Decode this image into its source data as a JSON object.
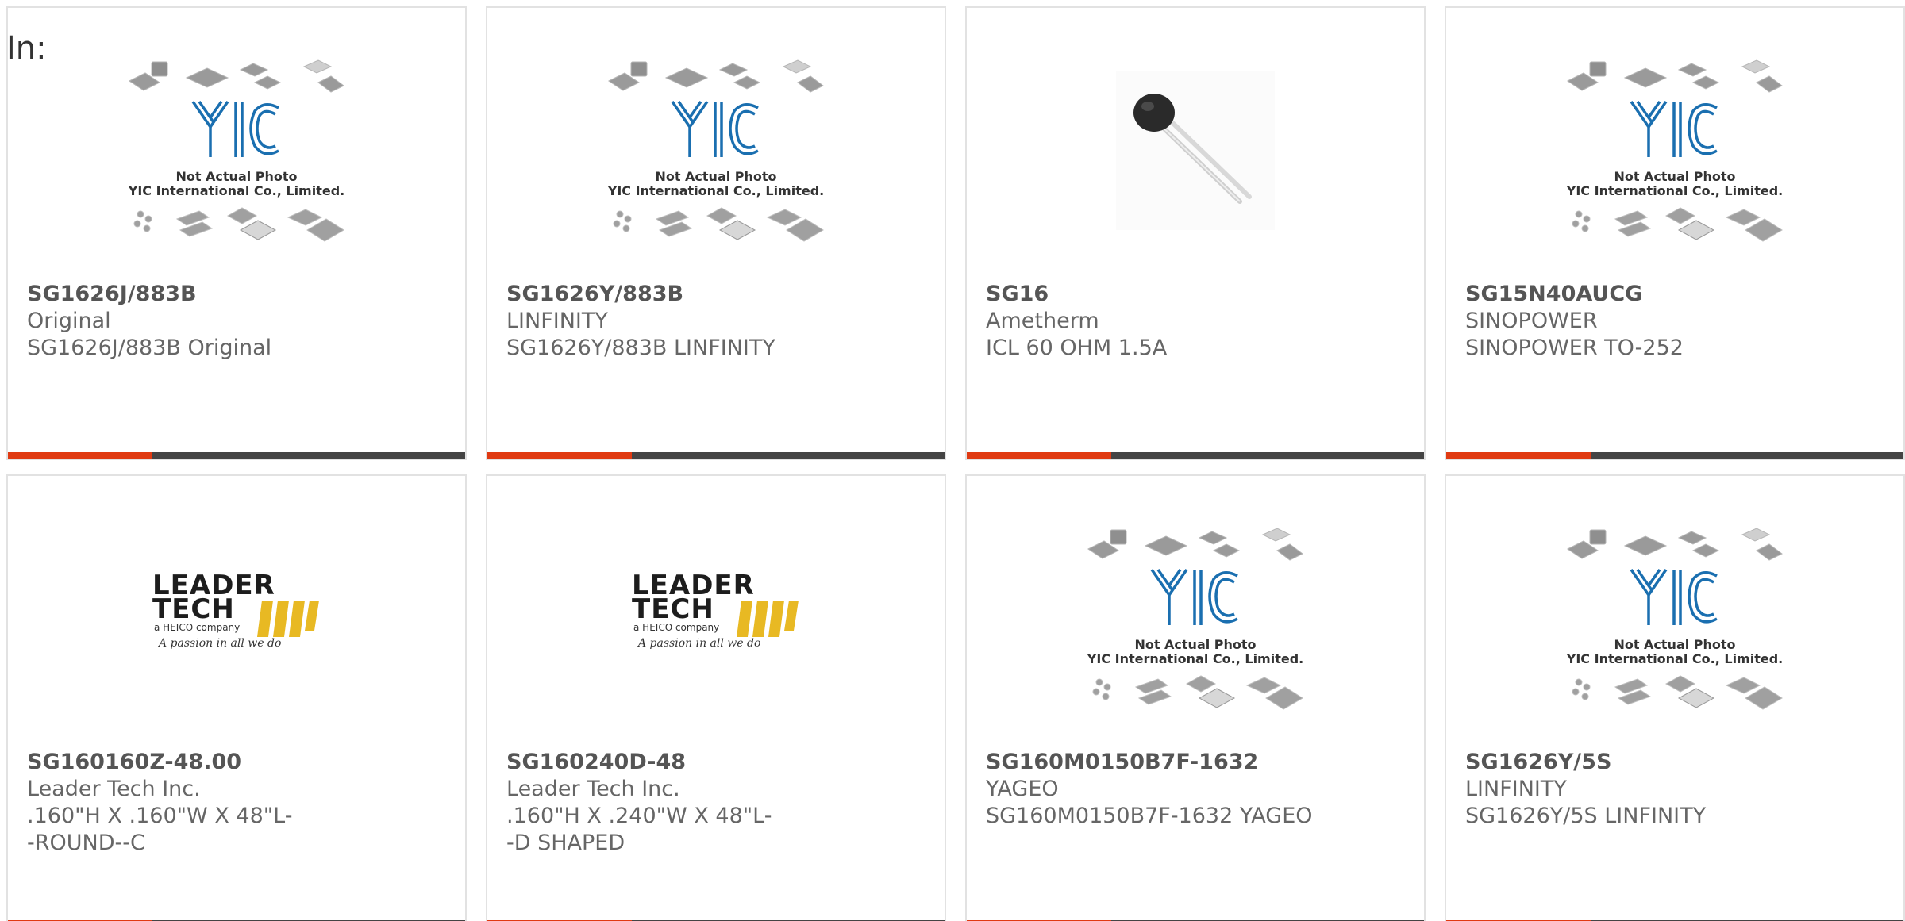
{
  "header": {
    "in_label": "In:"
  },
  "colors": {
    "accent": "#e03a12",
    "bar": "#444444",
    "yic_blue": "#1a6fb0",
    "leadertech_gold": "#e8b923"
  },
  "placeholder": {
    "caption_line1": "Not Actual Photo",
    "caption_line2": "YIC International Co., Limited.",
    "logo_text": "YIC"
  },
  "leadertech": {
    "line1": "LEADER",
    "line2": "TECH",
    "line3": "a HEICO company",
    "slogan": "A passion in all we do"
  },
  "products": [
    {
      "part_number": "SG1626J/883B",
      "manufacturer": "Original",
      "description": "SG1626J/883B Original",
      "image": "yic-placeholder"
    },
    {
      "part_number": "SG1626Y/883B",
      "manufacturer": "LINFINITY",
      "description": "SG1626Y/883B LINFINITY",
      "image": "yic-placeholder"
    },
    {
      "part_number": "SG16",
      "manufacturer": "Ametherm",
      "description": "ICL 60 OHM 1.5A",
      "image": "thermistor-photo"
    },
    {
      "part_number": "SG15N40AUCG",
      "manufacturer": "SINOPOWER",
      "description": "SINOPOWER TO-252",
      "image": "yic-placeholder"
    },
    {
      "part_number": "SG160160Z-48.00",
      "manufacturer": "Leader Tech Inc.",
      "description": ".160\"H X .160\"W X 48\"L--ROUND--C",
      "image": "leadertech-logo"
    },
    {
      "part_number": "SG160240D-48",
      "manufacturer": "Leader Tech Inc.",
      "description": ".160\"H X .240\"W X 48\"L--D SHAPED",
      "image": "leadertech-logo"
    },
    {
      "part_number": "SG160M0150B7F-1632",
      "manufacturer": "YAGEO",
      "description": "SG160M0150B7F-1632 YAGEO",
      "image": "yic-placeholder"
    },
    {
      "part_number": "SG1626Y/5S",
      "manufacturer": "LINFINITY",
      "description": "SG1626Y/5S LINFINITY",
      "image": "yic-placeholder"
    }
  ]
}
